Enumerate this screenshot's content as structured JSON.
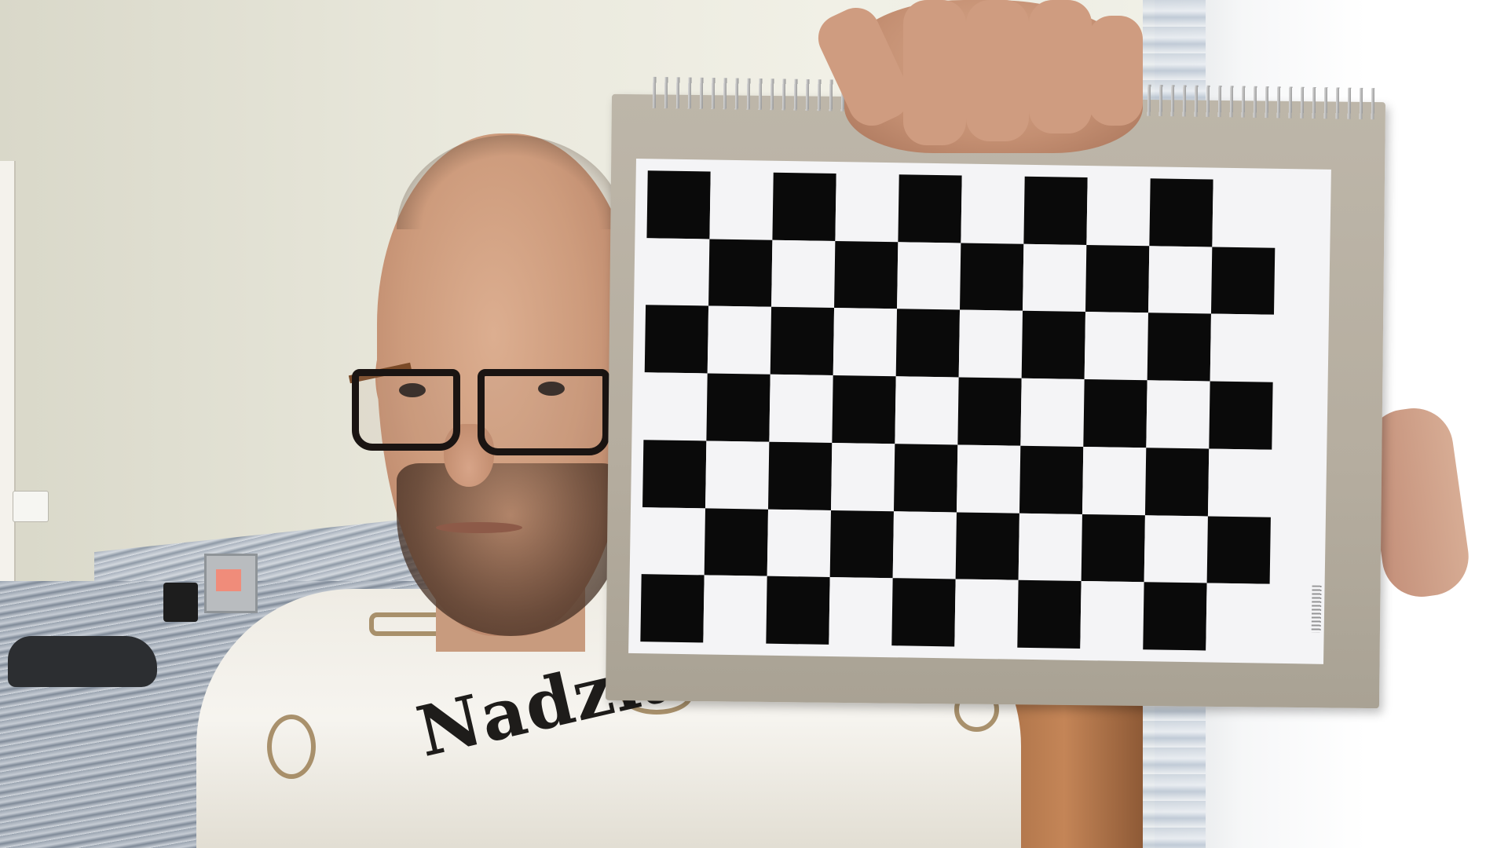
{
  "photo": {
    "subject": "person",
    "tshirt_print": "Nadziany"
  },
  "checkerboard": {
    "columns": 10,
    "rows": 7
  },
  "colors": {
    "wall": "#e9e8dc",
    "tshirt": "#f3f1eb",
    "board_black": "#0a0a0a",
    "board_white": "#f4f4f6",
    "notebook_cover": "#b8b0a2"
  }
}
